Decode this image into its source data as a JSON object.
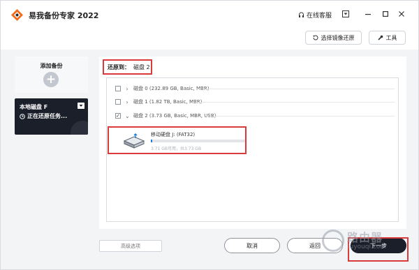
{
  "app": {
    "title": "易我备份专家 2022",
    "support_label": "在线客服",
    "icons": {
      "logo": "easeus-logo-icon",
      "support": "headset-icon",
      "menu": "menu-icon",
      "minimize": "minimize-icon",
      "maximize": "maximize-icon",
      "close": "close-icon"
    }
  },
  "toolbar": {
    "restore_image_label": "选择镜像还原",
    "tools_label": "工具"
  },
  "sidebar": {
    "add_backup_label": "添加备份",
    "task": {
      "title": "本地磁盘 F",
      "status": "正在还原任务..."
    }
  },
  "restore": {
    "label": "还原到：",
    "target": "磁盘 2"
  },
  "disks": [
    {
      "label": "磁盘 0 (232.89 GB, Basic, MBR)",
      "checked": false,
      "expanded": false
    },
    {
      "label": "磁盘 1 (1.82 TB, Basic, MBR)",
      "checked": false,
      "expanded": false
    },
    {
      "label": "磁盘 2 (3.73 GB, Basic, MBR, USB)",
      "checked": true,
      "expanded": true
    }
  ],
  "partition": {
    "name": "移动硬盘 J: (FAT32)",
    "size_text": "3.71 GB可用，共3.73 GB",
    "used_fraction": 0.005,
    "accent_color": "#1b7fdc"
  },
  "buttons": {
    "advanced": "高级选项",
    "cancel": "取消",
    "back": "返回",
    "next": "下一步"
  },
  "watermark": {
    "text": "路由器",
    "sub": "luyouqi.com"
  },
  "colors": {
    "highlight": "#d93a3a",
    "dark": "#1b1f2a"
  }
}
